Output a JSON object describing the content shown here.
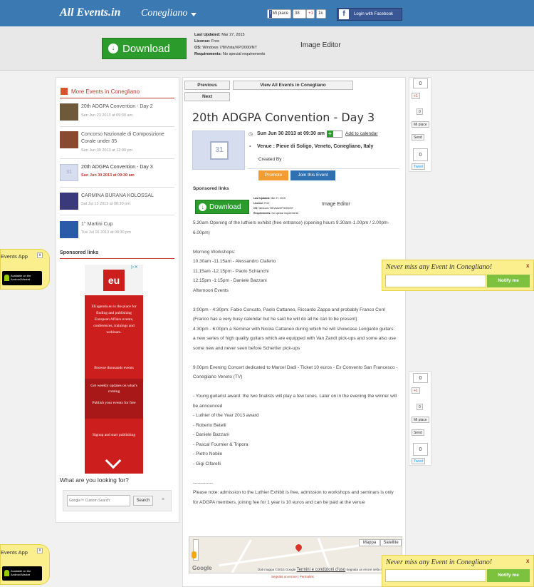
{
  "header": {
    "logo_all": "All",
    "logo_events": "Events.in",
    "city": "Conegliano",
    "share_fb": "Mi piace",
    "share_count": "38",
    "gplus": "+1",
    "gplus_count": "1k",
    "facebook_login": "Login with Facebook"
  },
  "top_ad": {
    "download": "Download",
    "last_updated_label": "Last Updated:",
    "last_updated_value": "Mar 27, 2015",
    "license_label": "License:",
    "license_value": "Free",
    "os_label": "OS:",
    "os_value": "Windows 7/8/Vista/XP/2000/NT",
    "requirements_label": "Requirements:",
    "requirements_value": "No special requirements",
    "product": "Image Editor"
  },
  "sidebar": {
    "more_title": "More Events in Conegliano",
    "events": [
      {
        "title": "20th ADGPA Convention - Day 2",
        "date": "Sun Jun 23 2013 at 09:30 am"
      },
      {
        "title": "Concorso Nazionale di Composizione Corale under 35",
        "date": "Sun Jun 30 2013 at 12:00 pm"
      },
      {
        "title": "20th ADGPA Convention - Day 3",
        "date": "Sun Jun 30 2013 at 09:30 am"
      },
      {
        "title": "CARMINA BURANA KOLOSSAL",
        "date": "Sat Jul 13 2013 at 08:30 pm"
      },
      {
        "title": "1° Martini Cup",
        "date": "Tue Jul 16 2013 at 08:30 pm"
      }
    ],
    "sponsored": "Sponsored links",
    "eu_logo": "eu",
    "eu_text": "EUagenda.eu is the place for finding and publishing European Affairs events, conferences, trainings and webinars.",
    "eu_browse": "Browse thousands events",
    "eu_weekly": "Get weekly updates on what's coming",
    "eu_publish": "Publish your events for free",
    "eu_signup": "Signup and start publishing",
    "looking_for": "What are you looking for?",
    "search_placeholder": "Google™ Custom Search",
    "search_button": "Search"
  },
  "main": {
    "previous": "Previous",
    "view_all": "View All Events in Conegliano",
    "next": "Next",
    "title": "20th ADGPA Convention - Day 3",
    "calendar_day": "31",
    "datetime": "Sun Jun 30 2013 at 09:30 am",
    "add_calendar": "Add to calendar",
    "venue_label": "Venue :",
    "venue": "Pieve di Soligo, Veneto, Conegliano, Italy",
    "created_by": "Created By :",
    "promote": "Promote",
    "join": "Join this Event",
    "sponsored": "Sponsored links",
    "body": [
      "5.30am Opening of the luthiers exhibit (free entrance) (opening hours 9.30am-1.00pm / 2.00pm-6.00pm)",
      "",
      "Morning Workshops:",
      "10.30am -11.15am - Alessandro Claferio",
      "11.15am -12.15pm - Paolo Schianchi",
      "12:15pm -1:15pm - Daniele Bazzani",
      "Afternoon Events",
      "",
      "3:00pm - 4:30pm: Fabio Concato, Paolo Cattaneo, Riccardo Zappa and probably Franco Cerri (Franco has a very busy calendar but he said he will do all he can to be present)",
      "4:30pm - 6:00pm a Seminar with Nicola Cattaneo during which he will showcase Lengardo guitars: a new series of high quality guitars which are equipped with Van Zandt pick-ups and some also use some new and never seen before Schertler pick-ups",
      "",
      "9.00pm Evening Concert dedicated to Marcel Dadi - Ticket 10 euros - Ex Convento San Francesco - Conegliano Veneto (TV)",
      "",
      "- Young guitarist award: the two finalists will play a few tunes. Later on in the evening the winner will be announced",
      "- Luthier of the Year 2013 award",
      "- Roberto Betelli",
      "- Daniele Bazzani",
      "- Pascal Fournier & Tripora",
      "- Pietro Nobile",
      "- Gigi Cifarelli",
      "",
      "-------------",
      "Please note: admission to the Luthier Exhibit is free, admission to workshops and seminars is only for ADGPA members, joining fee for 1 year is 10 euros and can be paid at the venue"
    ],
    "map_tab_map": "Mappa",
    "map_tab_sat": "Satellite",
    "map_google": "Google",
    "map_credits": "Dati mappa ©2015 Google",
    "map_terms": "Termini e condizioni d'uso",
    "map_report": "Segnala un errore nella mappa",
    "map_footer": "Segnala un errore | Permalink"
  },
  "share": {
    "count_top": "0",
    "gplus": "+1",
    "like_count": "0",
    "mi_piace": "Mi piace",
    "send": "Send",
    "tweet_count": "0",
    "tweet": "Tweet"
  },
  "popup": {
    "title": "Never miss any Event in Conegliano!",
    "notify": "Notify me",
    "close": "x"
  },
  "app_badge": {
    "label": "Events App",
    "market_line1": "Available on the",
    "market_line2": "Android Market",
    "close": "x"
  }
}
